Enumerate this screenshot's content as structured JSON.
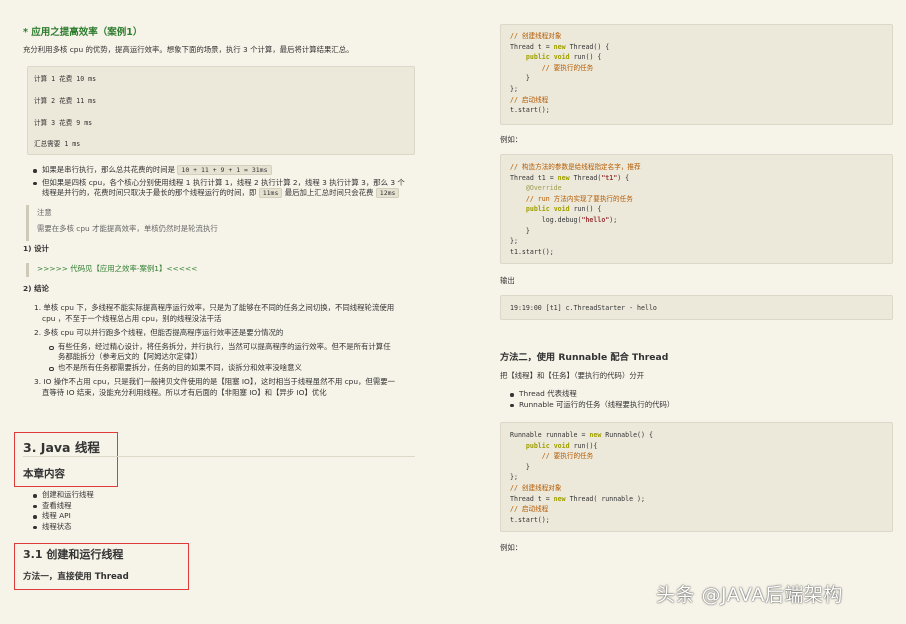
{
  "left": {
    "heading": "* 应用之提高效率（案例1）",
    "intro": "充分利用多核 cpu 的优势，提高运行效率。想象下面的场景，执行 3 个计算，最后将计算结果汇总。",
    "calc_lines": [
      "计算 1 花费 10 ms",
      "计算 2 花费 11 ms",
      "计算 3 花费 9 ms",
      "汇总需要 1 ms"
    ],
    "bullet1_text": "如果是串行执行，那么总共花费的时间是",
    "bullet1_code": "10 + 11 + 9 + 1 = 31ms",
    "bullet2_line1": "但如果是四核 cpu，各个核心分别使用线程 1 执行计算 1，线程 2 执行计算 2，线程 3 执行计算 3，那么 3 个",
    "bullet2_line2a": "线程是并行的，花费时间只取决于最长的那个线程运行的时间，即",
    "bullet2_code1": "11ms",
    "bullet2_line2b": "最后加上汇总时间只会花费",
    "bullet2_code2": "12ms",
    "note_title": "注意",
    "note_text": "需要在多核 cpu 才能提高效率，单核仍然时是轮流执行",
    "design_heading": "1) 设计",
    "design_link": ">>>>> 代码见【应用之效率-案例1】<<<<<",
    "conclusion_heading": "2) 结论",
    "c1_line1": "1. 单核 cpu 下，多线程不能实际提高程序运行效率，只是为了能够在不同的任务之间切换，不同线程轮流使用",
    "c1_line2": "cpu ，不至于一个线程总占用 cpu，别的线程没法干活",
    "c2": "2. 多核 cpu 可以并行跑多个线程，但能否提高程序运行效率还是要分情况的",
    "c2_sub1_line1": "有些任务，经过精心设计，将任务拆分，并行执行，当然可以提高程序的运行效率。但不是所有计算任",
    "c2_sub1_line2": "务都能拆分（参考后文的【阿姆达尔定律】）",
    "c2_sub2": "也不是所有任务都需要拆分，任务的目的如果不同，谈拆分和效率没啥意义",
    "c3_line1": "3. IO 操作不占用 cpu，只是我们一般拷贝文件使用的是【阻塞 IO】，这时相当于线程虽然不用 cpu，但需要一",
    "c3_line2": "直等待 IO 结束，没能充分利用线程。所以才有后面的【非阻塞 IO】和【异步 IO】优化",
    "chapter_title": "3. Java 线程",
    "chapter_content": "本章内容",
    "toc": [
      "创建和运行线程",
      "查看线程",
      "线程 API",
      "线程状态"
    ],
    "section_title": "3.1 创建和运行线程",
    "method1": "方法一，直接使用 Thread"
  },
  "right": {
    "code1": [
      {
        "t": "// 创建线程对象",
        "c": "cm"
      },
      {
        "t": "Thread t = new Thread() {",
        "c": ""
      },
      {
        "t": "    public void run() {",
        "c": ""
      },
      {
        "t": "        // 要执行的任务",
        "c": "cm"
      },
      {
        "t": "    }",
        "c": ""
      },
      {
        "t": "};",
        "c": ""
      },
      {
        "t": "// 启动线程",
        "c": "cm"
      },
      {
        "t": "t.start();",
        "c": ""
      }
    ],
    "example1": "例如：",
    "code2": [
      {
        "t": "// 构造方法的参数是给线程指定名字，推荐",
        "c": "cm"
      },
      {
        "t": "Thread t1 = new Thread(\"t1\") {",
        "c": ""
      },
      {
        "t": "    @Override",
        "c": "annot"
      },
      {
        "t": "    // run 方法内实现了要执行的任务",
        "c": "cm"
      },
      {
        "t": "    public void run() {",
        "c": ""
      },
      {
        "t": "        log.debug(\"hello\");",
        "c": ""
      },
      {
        "t": "    }",
        "c": ""
      },
      {
        "t": "};",
        "c": ""
      },
      {
        "t": "t1.start();",
        "c": ""
      }
    ],
    "output_label": "输出",
    "output_line": "19:19:00 [t1] c.ThreadStarter - hello",
    "method2": "方法二，使用 Runnable 配合 Thread",
    "method2_desc": "把【线程】和【任务】（要执行的代码）分开",
    "method2_bullets": [
      "Thread 代表线程",
      "Runnable 可运行的任务（线程要执行的代码）"
    ],
    "code3": [
      {
        "t": "Runnable runnable = new Runnable() {",
        "c": ""
      },
      {
        "t": "    public void run(){",
        "c": ""
      },
      {
        "t": "        // 要执行的任务",
        "c": "cm"
      },
      {
        "t": "    }",
        "c": ""
      },
      {
        "t": "};",
        "c": ""
      },
      {
        "t": "// 创建线程对象",
        "c": "cm"
      },
      {
        "t": "Thread t = new Thread( runnable );",
        "c": ""
      },
      {
        "t": "// 启动线程",
        "c": "cm"
      },
      {
        "t": "t.start();",
        "c": ""
      }
    ],
    "example2": "例如："
  },
  "watermark": "头条 @JAVA后端架构",
  "colors": {
    "background": "#f6f3e8",
    "heading_green": "#2e7d2e",
    "highlight_box": "#e03b3b"
  }
}
